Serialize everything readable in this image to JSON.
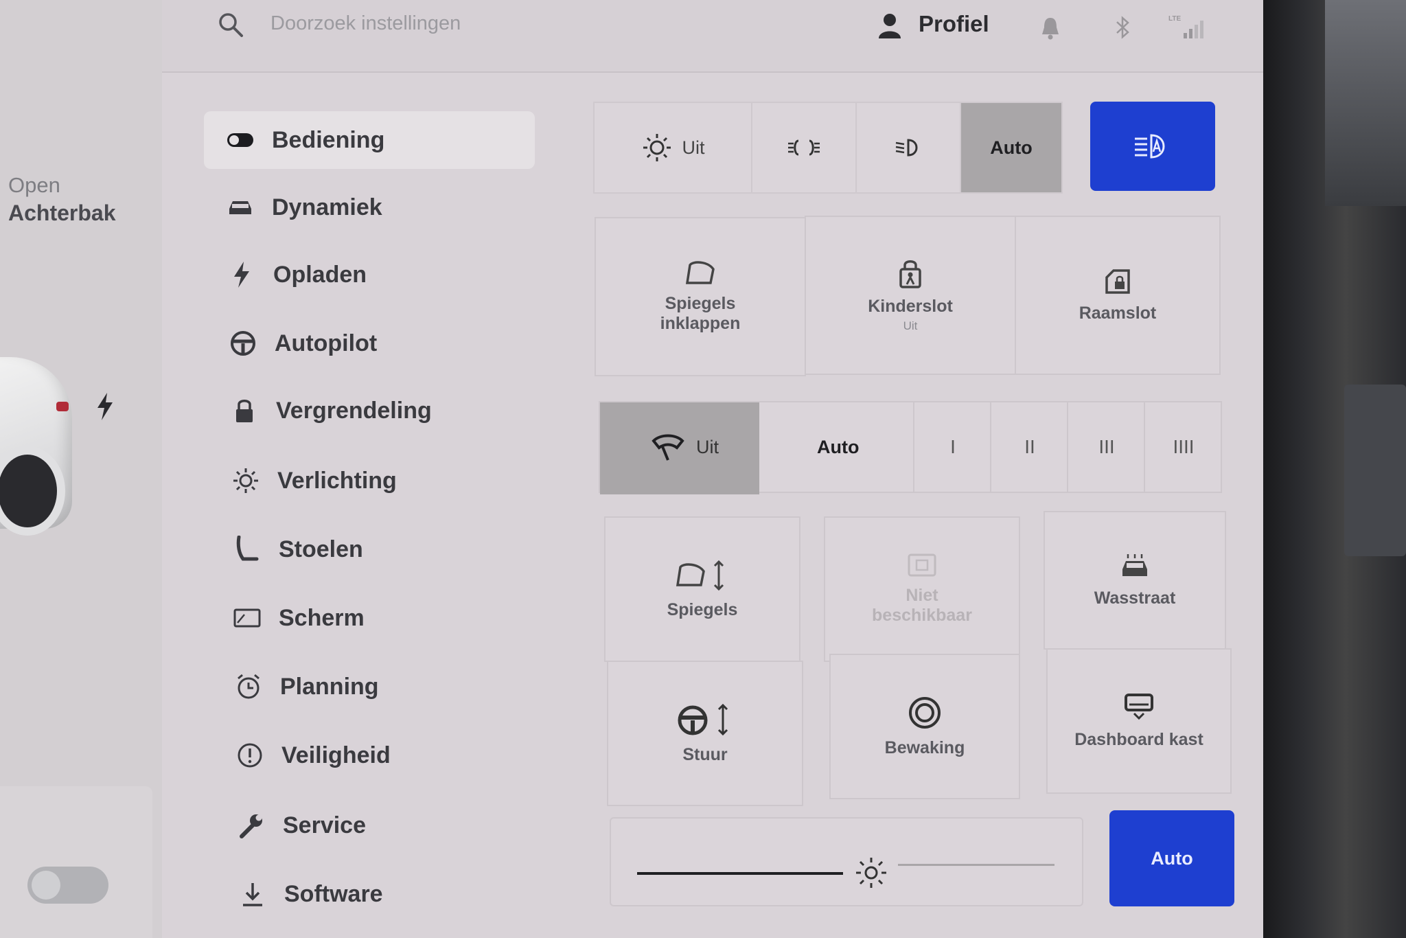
{
  "left": {
    "open_label": "Open",
    "trunk_label": "Achterbak"
  },
  "topbar": {
    "search_placeholder": "Doorzoek instellingen",
    "profile_label": "Profiel",
    "signal_label": "LTE"
  },
  "sidebar": {
    "items": [
      {
        "label": "Bediening",
        "icon": "toggle-icon",
        "active": true
      },
      {
        "label": "Dynamiek",
        "icon": "car-icon"
      },
      {
        "label": "Opladen",
        "icon": "bolt-icon"
      },
      {
        "label": "Autopilot",
        "icon": "steering-wheel-icon"
      },
      {
        "label": "Vergrendeling",
        "icon": "lock-icon"
      },
      {
        "label": "Verlichting",
        "icon": "sun-icon"
      },
      {
        "label": "Stoelen",
        "icon": "seat-icon"
      },
      {
        "label": "Scherm",
        "icon": "screen-icon"
      },
      {
        "label": "Planning",
        "icon": "alarm-clock-icon"
      },
      {
        "label": "Veiligheid",
        "icon": "alert-circle-icon"
      },
      {
        "label": "Service",
        "icon": "wrench-icon"
      },
      {
        "label": "Software",
        "icon": "download-icon"
      }
    ]
  },
  "lights": {
    "off_label": "Uit",
    "auto_label": "Auto",
    "selected": "Auto"
  },
  "controls": {
    "fold_mirrors": {
      "line1": "Spiegels",
      "line2": "inklappen"
    },
    "child_lock": {
      "label": "Kinderslot",
      "status": "Uit"
    },
    "window_lock": {
      "label": "Raamslot"
    }
  },
  "wipers": {
    "off_label": "Uit",
    "auto_label": "Auto",
    "speeds": [
      "I",
      "II",
      "III",
      "IIII"
    ],
    "selected": "Uit"
  },
  "adjust": {
    "mirrors": "Spiegels",
    "unavailable_line1": "Niet",
    "unavailable_line2": "beschikbaar",
    "car_wash": "Wasstraat",
    "steering": "Stuur",
    "sentry": "Bewaking",
    "glovebox": "Dashboard kast"
  },
  "brightness": {
    "auto_label": "Auto"
  },
  "colors": {
    "accent_blue": "#1e3fd0",
    "selected_gray": "#a9a6a8",
    "panel_bg": "#d9d3d8"
  }
}
